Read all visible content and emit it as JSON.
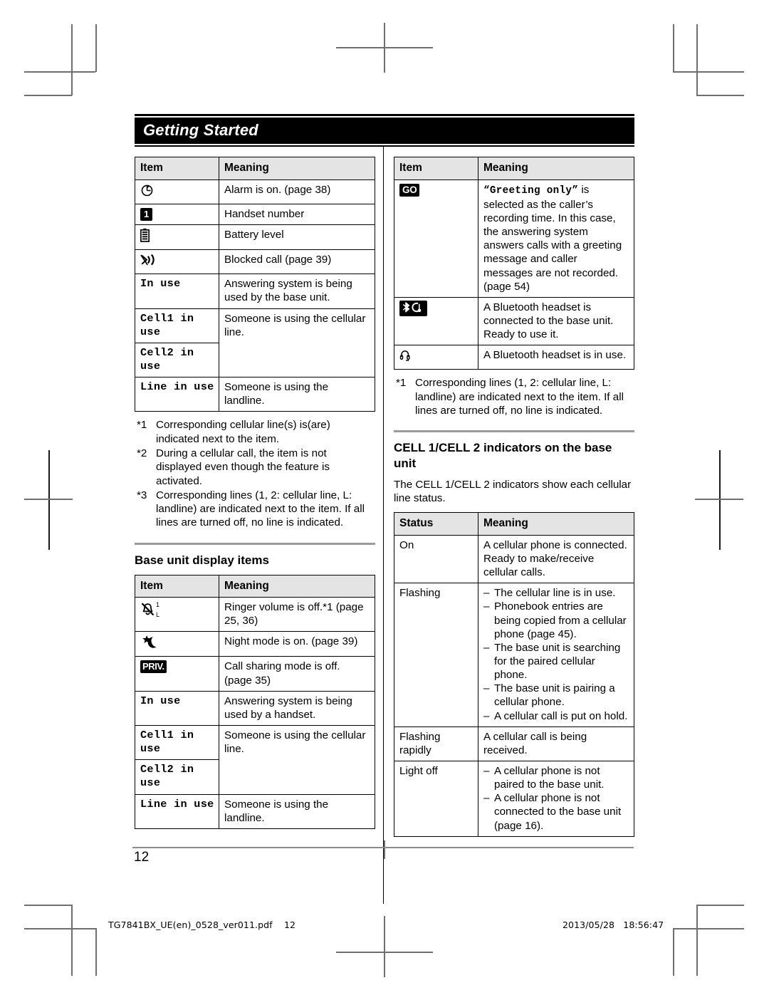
{
  "header": {
    "chapter_title": "Getting Started"
  },
  "left_column": {
    "table_handset": {
      "headers": [
        "Item",
        "Meaning"
      ],
      "rows": [
        {
          "icon": "alarm-clock-icon",
          "item_text": "",
          "meaning": "Alarm is on. (page 38)"
        },
        {
          "icon": "handset-number-badge-icon",
          "item_text": "1",
          "meaning": "Handset number"
        },
        {
          "icon": "battery-level-icon",
          "item_text": "",
          "meaning": "Battery level"
        },
        {
          "icon": "blocked-call-icon",
          "item_text": "",
          "meaning": "Blocked call (page 39)"
        },
        {
          "icon": "",
          "item_text": "In use",
          "mono": true,
          "meaning": "Answering system is being used by the base unit."
        },
        {
          "icon": "",
          "item_text": "Cell1 in use",
          "mono": true,
          "meaning": "Someone is using the cellular line."
        },
        {
          "icon": "",
          "item_text": "Cell2 in use",
          "mono": true,
          "meaning": ""
        },
        {
          "icon": "",
          "item_text": "Line in use",
          "mono": true,
          "meaning": "Someone is using the landline."
        }
      ]
    },
    "footnotes": [
      {
        "tag": "*1",
        "text": "Corresponding cellular line(s) is(are) indicated next to the item."
      },
      {
        "tag": "*2",
        "text": "During a cellular call, the item is not displayed even though the feature is activated."
      },
      {
        "tag": "*3",
        "text": "Corresponding lines (1, 2: cellular line, L: landline) are indicated next to the item. If all lines are turned off, no line is indicated."
      }
    ],
    "section_title": "Base unit display items",
    "table_base": {
      "headers": [
        "Item",
        "Meaning"
      ],
      "rows": [
        {
          "icon": "ringer-off-icon",
          "item_text": "",
          "sup": "1",
          "sub": "L",
          "meaning": "Ringer volume is off.*1 (page 25, 36)"
        },
        {
          "icon": "night-mode-icon",
          "item_text": "",
          "meaning": "Night mode is on. (page 39)"
        },
        {
          "icon": "priv-badge-icon",
          "item_text": "PRIV.",
          "meaning": "Call sharing mode is off. (page 35)"
        },
        {
          "icon": "",
          "item_text": "In use",
          "mono": true,
          "meaning": "Answering system is being used by a handset."
        },
        {
          "icon": "",
          "item_text": "Cell1 in use",
          "mono": true,
          "meaning": "Someone is using the cellular line."
        },
        {
          "icon": "",
          "item_text": "Cell2 in use",
          "mono": true,
          "meaning": ""
        },
        {
          "icon": "",
          "item_text": "Line in use",
          "mono": true,
          "meaning": "Someone is using the landline."
        }
      ]
    }
  },
  "right_column": {
    "table_more": {
      "headers": [
        "Item",
        "Meaning"
      ],
      "rows": [
        {
          "icon": "greeting-only-badge-icon",
          "item_text": "GO",
          "meaning_quoted": "“Greeting only”",
          "meaning": " is selected as the caller’s recording time. In this case, the answering system answers calls with a greeting message and caller messages are not recorded. (page 54)"
        },
        {
          "icon": "bluetooth-headset-connected-icon",
          "item_text": "",
          "meaning": "A Bluetooth headset is connected to the base unit. Ready to use it."
        },
        {
          "icon": "headset-in-use-icon",
          "item_text": "",
          "meaning": "A Bluetooth headset is in use."
        }
      ]
    },
    "footnotes": [
      {
        "tag": "*1",
        "text": "Corresponding lines (1, 2: cellular line, L: landline) are indicated next to the item. If all lines are turned off, no line is indicated."
      }
    ],
    "section_title": "CELL 1/CELL 2 indicators on the base unit",
    "section_intro": "The CELL 1/CELL 2 indicators show each cellular line status.",
    "table_status": {
      "headers": [
        "Status",
        "Meaning"
      ],
      "rows": [
        {
          "status": "On",
          "meaning": "A cellular phone is connected. Ready to make/receive cellular calls.",
          "items": []
        },
        {
          "status": "Flashing",
          "meaning": "",
          "items": [
            "The cellular line is in use.",
            "Phonebook entries are being copied from a cellular phone (page 45).",
            "The base unit is searching for the paired cellular phone.",
            "The base unit is pairing a cellular phone.",
            "A cellular call is put on hold."
          ]
        },
        {
          "status": "Flashing rapidly",
          "meaning": "A cellular call is being received.",
          "items": []
        },
        {
          "status": "Light off",
          "meaning": "",
          "items": [
            "A cellular phone is not paired to the base unit.",
            "A cellular phone is not connected to the base unit (page 16)."
          ]
        }
      ]
    }
  },
  "footer": {
    "page_number": "12",
    "file_name": "TG7841BX_UE(en)_0528_ver011.pdf",
    "file_page": "12",
    "date": "2013/05/28",
    "time": "18:56:47"
  },
  "colors": {
    "banner_bg": "#000000",
    "banner_text": "#ffffff",
    "table_header_bg": "#e4e4e4",
    "rule": "#9a9a9a"
  }
}
